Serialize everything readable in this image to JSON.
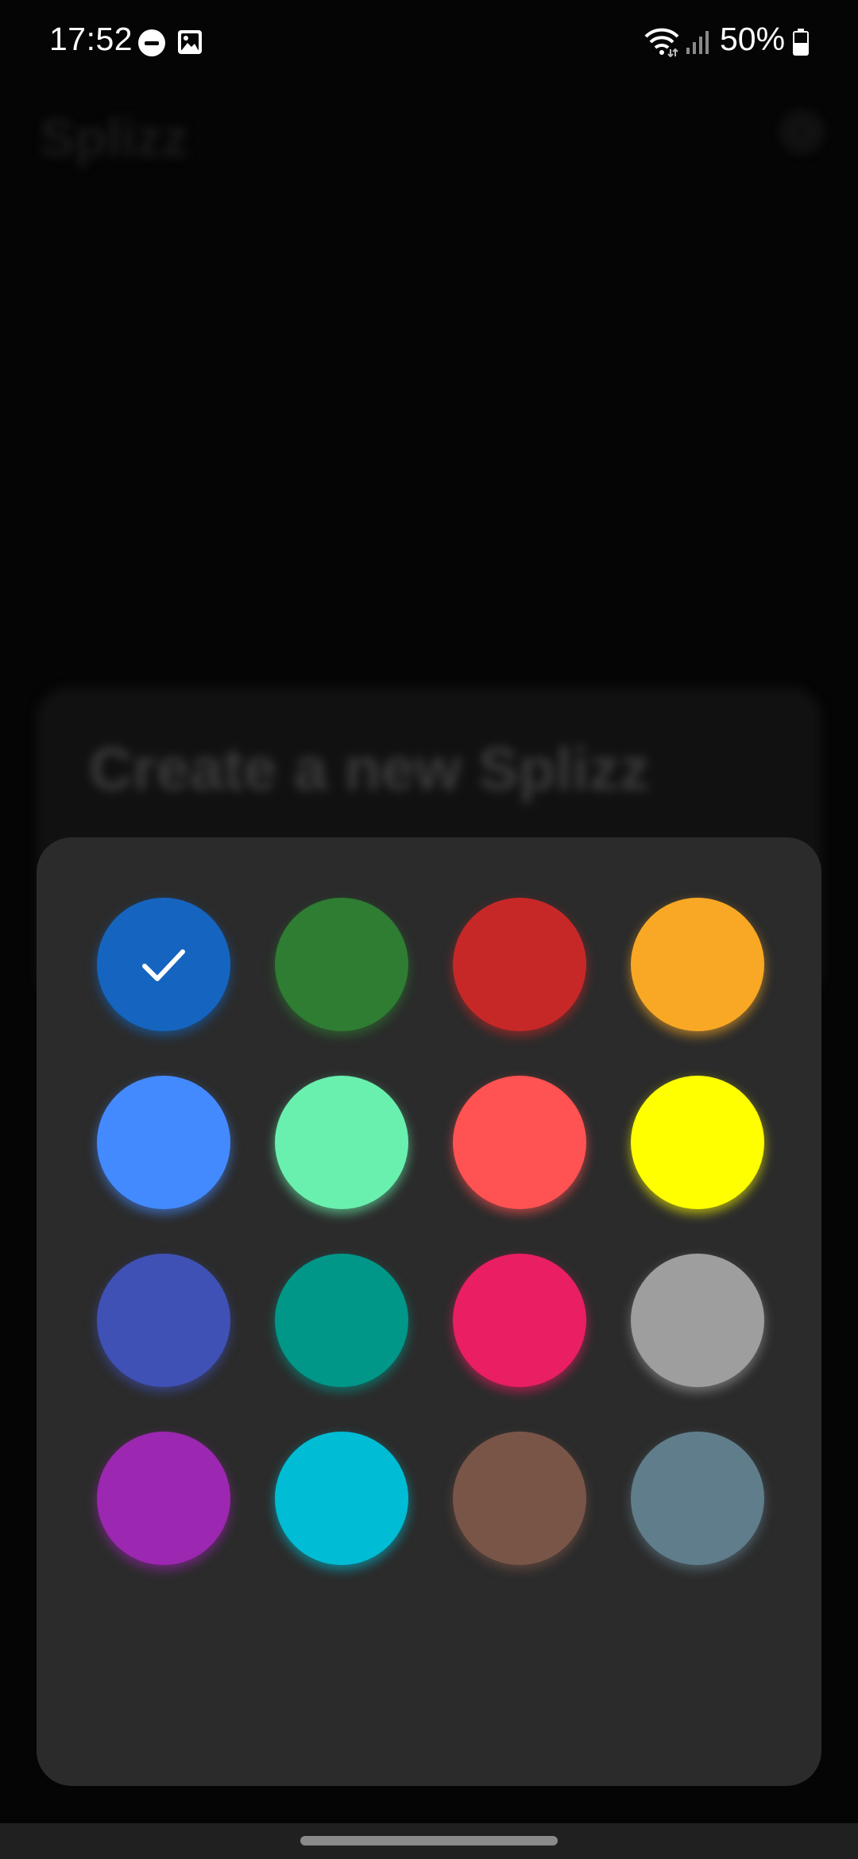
{
  "status_bar": {
    "time": "17:52",
    "battery_percent": "50%",
    "icons": [
      "do-not-disturb-icon",
      "gallery-icon",
      "wifi-icon",
      "signal-icon",
      "battery-icon"
    ]
  },
  "app": {
    "title": "Splizz",
    "settings_icon": "gear-icon",
    "new_card_title": "Create a new Splizz"
  },
  "color_picker": {
    "selected_index": 0,
    "selected_icon": "check-icon",
    "swatches": [
      {
        "color": "#1565C0"
      },
      {
        "color": "#2E7D32"
      },
      {
        "color": "#C62828"
      },
      {
        "color": "#F9A825"
      },
      {
        "color": "#448AFF"
      },
      {
        "color": "#69F0AE"
      },
      {
        "color": "#FF5252"
      },
      {
        "color": "#FFFF00"
      },
      {
        "color": "#3F51B5"
      },
      {
        "color": "#009688"
      },
      {
        "color": "#E91E63"
      },
      {
        "color": "#9E9E9E"
      },
      {
        "color": "#9C27B0"
      },
      {
        "color": "#00BCD4"
      },
      {
        "color": "#795548"
      },
      {
        "color": "#607D8B"
      }
    ]
  }
}
